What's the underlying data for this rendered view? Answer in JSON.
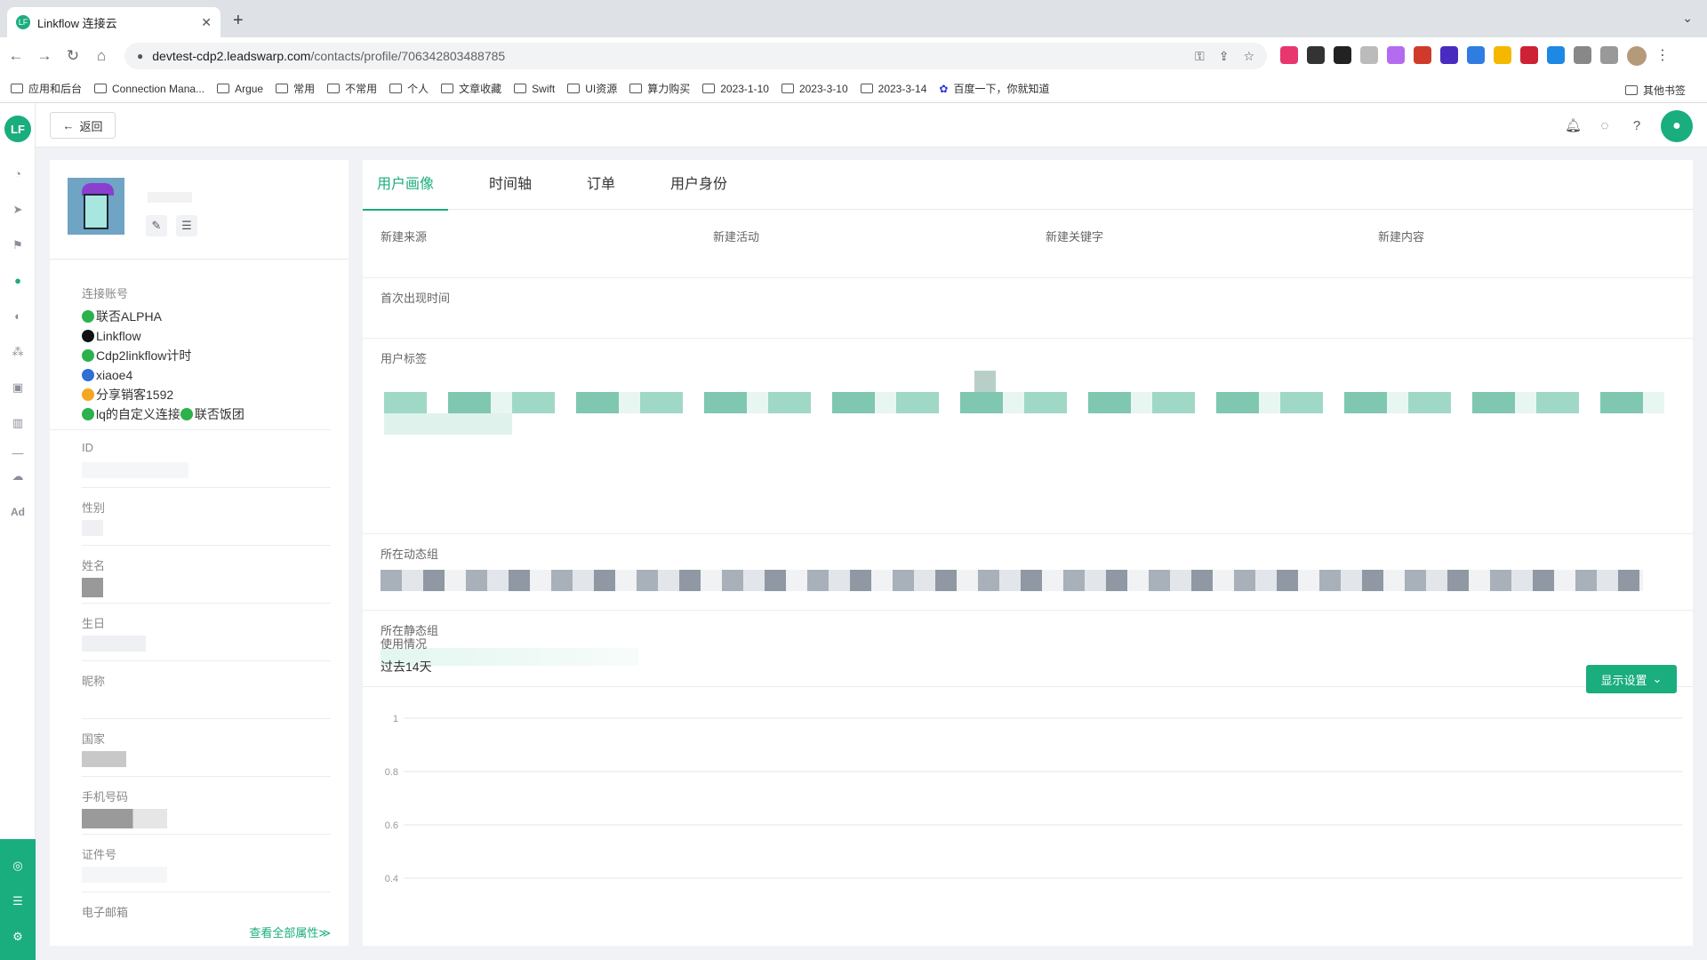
{
  "browser": {
    "tab_title": "Linkflow 连接云",
    "tab_close": "✕",
    "new_tab": "+",
    "url_host": "devtest-cdp2.leadswarp.com",
    "url_path": "/contacts/profile/706342803488785",
    "bookmarks": [
      "应用和后台",
      "Connection Mana...",
      "Argue",
      "常用",
      "不常用",
      "个人",
      "文章收藏",
      "Swift",
      "UI资源",
      "算力购买",
      "2023-1-10",
      "2023-3-10",
      "2023-3-14",
      "百度一下，你就知道"
    ],
    "other_bookmarks": "其他书签"
  },
  "topbar": {
    "back_label": "返回",
    "logo_text": "LF"
  },
  "profile": {
    "accounts_label": "连接账号",
    "accounts": [
      {
        "name": "联否ALPHA",
        "color": "#2bb24c"
      },
      {
        "name": "Linkflow",
        "color": "#111111"
      },
      {
        "name": "Cdp2linkflow计时",
        "color": "#2bb24c"
      },
      {
        "name": "xiaoe4",
        "color": "#2f6fd6"
      },
      {
        "name": "分享销客1592",
        "color": "#f5a623"
      },
      {
        "name": "lq的自定义连接",
        "color": "#2bb24c"
      }
    ],
    "account_extra": "联否饭团",
    "fields": [
      "ID",
      "性别",
      "姓名",
      "生日",
      "昵称",
      "国家",
      "手机号码",
      "证件号",
      "电子邮箱"
    ],
    "view_all": "查看全部属性≫"
  },
  "main": {
    "tabs": [
      "用户画像",
      "时间轴",
      "订单",
      "用户身份"
    ],
    "active_tab": 0,
    "grid": [
      "新建来源",
      "新建活动",
      "新建关键字",
      "新建内容"
    ],
    "first_seen": "首次出现时间",
    "user_tags": "用户标签",
    "dynamic_groups": "所在动态组",
    "static_groups": "所在静态组",
    "usage": "使用情况",
    "range": "过去14天",
    "display_settings": "显示设置"
  },
  "chart_data": {
    "type": "line",
    "title": "",
    "xlabel": "",
    "ylabel": "",
    "ylim": [
      0.4,
      1
    ],
    "yticks": [
      "1",
      "0.8",
      "0.6",
      "0.4"
    ],
    "series": []
  },
  "colors": {
    "accent": "#1aad7e"
  }
}
